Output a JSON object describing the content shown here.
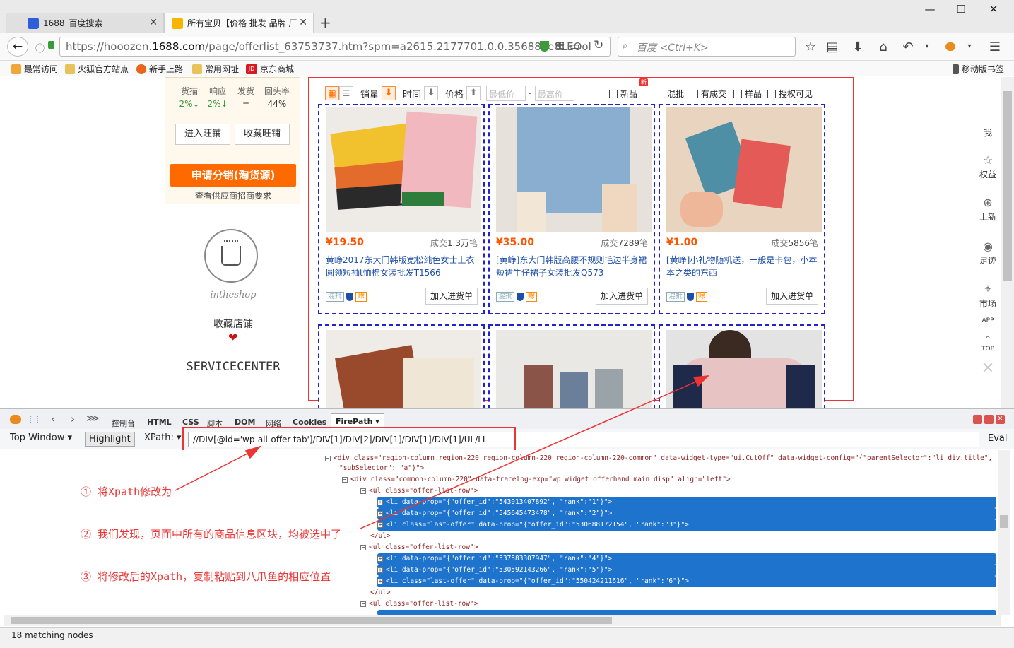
{
  "browser": {
    "tabs": [
      {
        "title": "1688_百度搜索"
      },
      {
        "title": "所有宝贝【价格 批发 品牌 厂"
      }
    ],
    "url_prefix": "https://hooozen.",
    "url_domain": "1688.com",
    "url_rest": "/page/offerlist_63753737.htm?spm=a2615.2177701.0.0.35688ae8LEOol",
    "search_placeholder": "百度 <Ctrl+K>",
    "bookmarks": [
      "最常访问",
      "火狐官方站点",
      "新手上路",
      "常用网址",
      "京东商城"
    ],
    "mobile_bookmarks": "移动版书签",
    "jd_badge": "JD"
  },
  "shop": {
    "stats": [
      {
        "label": "货描",
        "value": "2%↓"
      },
      {
        "label": "响应",
        "value": "2%↓"
      },
      {
        "label": "发货",
        "value": "="
      },
      {
        "label": "回头率",
        "value": "44%"
      }
    ],
    "btn_wangwang": "进入旺铺",
    "btn_collect": "收藏旺铺",
    "distribute": "申请分销(淘货源)",
    "distribute_sub": "查看供应商招商要求",
    "shop_name_script": "intheshop",
    "collect_store": "收藏店铺",
    "service": "SERVICECENTER"
  },
  "toolbar": {
    "sales": "销量",
    "time": "时间",
    "price": "价格",
    "min_price": "最低价",
    "dash": "-",
    "max_price": "最高价",
    "new_badge": "新",
    "filters": [
      "新品",
      "混批",
      "有成交",
      "样品",
      "授权可见"
    ]
  },
  "products": [
    {
      "price": "¥19.50",
      "sold_prefix": "成交",
      "sold_value": "1.3万",
      "sold_suffix": "笔",
      "title": "黄峥2017东大门韩版宽松纯色女士上衣圆领短袖t恤棉女装批发T1566",
      "tag1": "混批",
      "tag2": "赊",
      "btn": "加入进货单",
      "image": "colorful-tshirts"
    },
    {
      "price": "¥35.00",
      "sold_prefix": "成交",
      "sold_value": "7289",
      "sold_suffix": "笔",
      "title": "[黄峥]东大门韩版高腰不规则毛边半身裙短裙牛仔裙子女装批发Q573",
      "tag1": "混批",
      "tag2": "赊",
      "btn": "加入进货单",
      "image": "denim-skirt"
    },
    {
      "price": "¥1.00",
      "sold_prefix": "成交",
      "sold_value": "5856",
      "sold_suffix": "笔",
      "title": "[黄峥]小礼物随机送，一般是卡包，小本本之类的东西",
      "tag1": "混批",
      "tag2": "赊",
      "btn": "加入进货单",
      "image": "gift-cards"
    },
    {
      "image": "sweaters"
    },
    {
      "image": "tank-tops"
    },
    {
      "image": "raglan-tee"
    }
  ],
  "rightbar": [
    "我",
    "权益",
    "上新",
    "足迹",
    "市场",
    "APP",
    "TOP"
  ],
  "devtools": {
    "tabs": [
      "控制台",
      "HTML",
      "CSS",
      "脚本",
      "DOM",
      "网络",
      "Cookies",
      "FirePath"
    ],
    "top_window": "Top Window",
    "highlight": "Highlight",
    "xpath_label": "XPath:",
    "xpath_value": "//DIV[@id='wp-all-offer-tab']/DIV[1]/DIV[2]/DIV[1]/DIV[1]/DIV[1]/UL/LI",
    "eval": "Eval",
    "code_lines": [
      {
        "text": "<div  class=\"region-column region-220 region-column-220 region-column-220-common\"  data-widget-type=\"ui.CutOff\"  data-widget-config=\"{\"parentSelector\":\"li div.title\",",
        "selected": false
      },
      {
        "text": "\"subSelector\": \"a\"}\">",
        "selected": false
      },
      {
        "text": "<div  class=\"common-column-220\"  data-tracelog-exp=\"wp_widget_offerhand_main_disp\"  align=\"left\">",
        "selected": false
      },
      {
        "text": "<ul  class=\"offer-list-row\">",
        "selected": false
      },
      {
        "text": "<li  data-prop=\"{\"offer_id\":\"543913407892\", \"rank\":\"1\"}\">",
        "selected": true
      },
      {
        "text": "<li  data-prop=\"{\"offer_id\":\"545645473478\", \"rank\":\"2\"}\">",
        "selected": true
      },
      {
        "text": "<li  class=\"last-offer\"  data-prop=\"{\"offer_id\":\"530688172154\", \"rank\":\"3\"}\">",
        "selected": true
      },
      {
        "text": "</ul>",
        "selected": false
      },
      {
        "text": "<ul  class=\"offer-list-row\">",
        "selected": false
      },
      {
        "text": "<li  data-prop=\"{\"offer_id\":\"537583307947\", \"rank\":\"4\"}\">",
        "selected": true
      },
      {
        "text": "<li  data-prop=\"{\"offer_id\":\"530592143266\", \"rank\":\"5\"}\">",
        "selected": true
      },
      {
        "text": "<li  class=\"last-offer\"  data-prop=\"{\"offer_id\":\"550424211616\", \"rank\":\"6\"}\">",
        "selected": true
      },
      {
        "text": "</ul>",
        "selected": false
      },
      {
        "text": "<ul  class=\"offer-list-row\">",
        "selected": false
      }
    ],
    "status": "18 matching nodes"
  },
  "annotations": [
    "① 将Xpath修改为",
    "② 我们发现，页面中所有的商品信息区块，均被选中了",
    "③ 将修改后的Xpath，复制粘贴到八爪鱼的相应位置"
  ],
  "colors": {
    "accent": "#ff5500",
    "highlight_red": "#ee3333",
    "select_blue": "#1e73cc",
    "dash_blue": "#2222cc"
  }
}
